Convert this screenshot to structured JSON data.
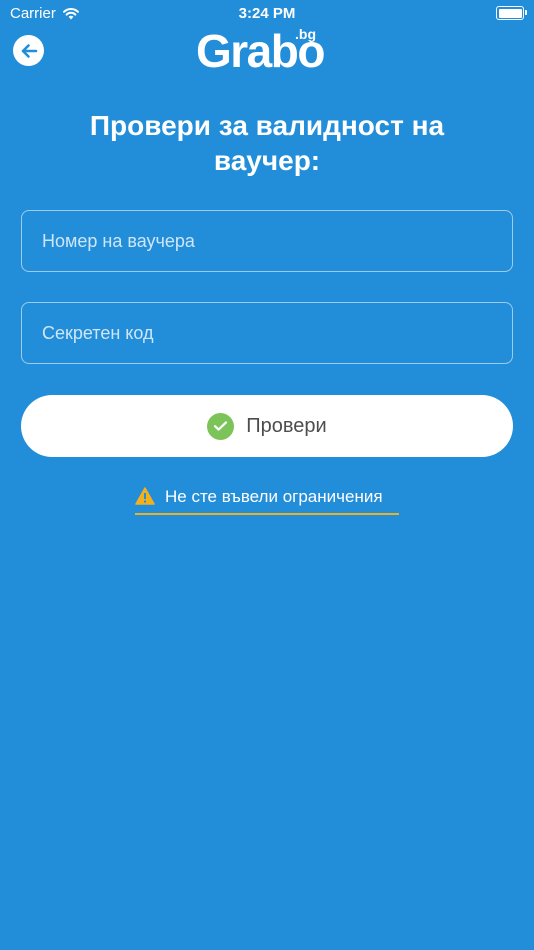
{
  "status_bar": {
    "carrier": "Carrier",
    "time": "3:24 PM"
  },
  "header": {
    "logo_main": "Grabo",
    "logo_sub": ".bg",
    "back_icon": "arrow-left-icon"
  },
  "title": "Провери за валидност на ваучер:",
  "form": {
    "voucher_placeholder": "Номер на ваучера",
    "secret_placeholder": "Секретен код",
    "voucher_value": "",
    "secret_value": ""
  },
  "check_button": {
    "label": "Провери",
    "icon": "check-circle-icon"
  },
  "warning": {
    "text": "Не сте въвели ограничения",
    "icon": "warning-triangle-icon"
  },
  "colors": {
    "background": "#228ed9",
    "check_icon": "#7cc45a",
    "warning_underline": "#e8b32a",
    "warning_icon": "#f2b01e",
    "button_text": "#4d4d4d"
  }
}
